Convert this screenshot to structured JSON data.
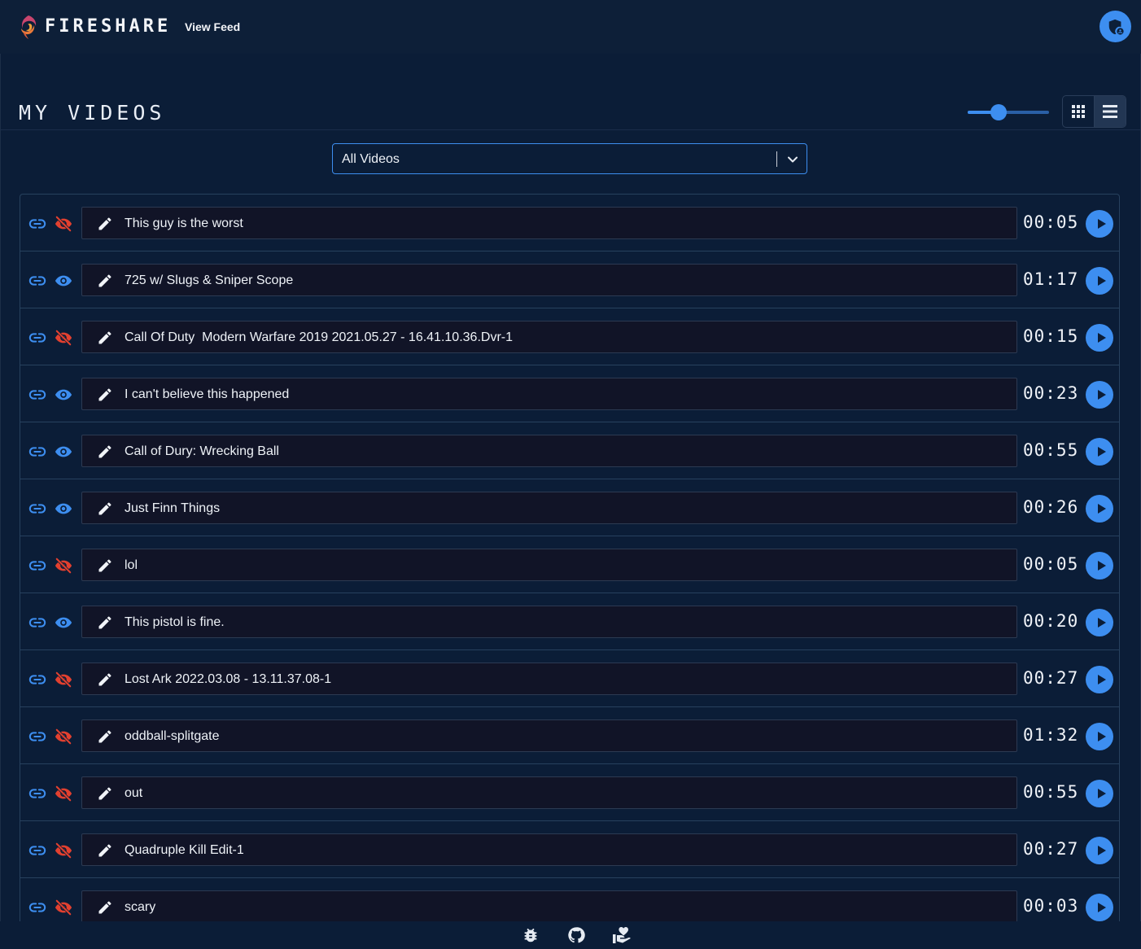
{
  "header": {
    "brand": "FIRESHARE",
    "nav_link": "View Feed",
    "avatar_icon": "shield-user-icon"
  },
  "page": {
    "title": "MY VIDEOS",
    "size_slider_value": 0.38,
    "view_modes": [
      "grid",
      "list"
    ],
    "active_view": "list"
  },
  "filter": {
    "selected": "All Videos"
  },
  "colors": {
    "accent": "#3d8ef0",
    "private": "#e2402f",
    "background": "#0b1d37"
  },
  "videos": [
    {
      "title": "This guy is the worst",
      "duration": "00:05",
      "visibility": "private"
    },
    {
      "title": "725 w/ Slugs & Sniper Scope",
      "duration": "01:17",
      "visibility": "public"
    },
    {
      "title": "Call Of Duty  Modern Warfare 2019 2021.05.27 - 16.41.10.36.Dvr-1",
      "duration": "00:15",
      "visibility": "private"
    },
    {
      "title": "I can't believe this happened",
      "duration": "00:23",
      "visibility": "public"
    },
    {
      "title": "Call of Dury: Wrecking Ball",
      "duration": "00:55",
      "visibility": "public"
    },
    {
      "title": "Just Finn Things",
      "duration": "00:26",
      "visibility": "public"
    },
    {
      "title": "lol",
      "duration": "00:05",
      "visibility": "private"
    },
    {
      "title": "This pistol is fine.",
      "duration": "00:20",
      "visibility": "public"
    },
    {
      "title": "Lost Ark 2022.03.08 - 13.11.37.08-1",
      "duration": "00:27",
      "visibility": "private"
    },
    {
      "title": "oddball-splitgate",
      "duration": "01:32",
      "visibility": "private"
    },
    {
      "title": "out",
      "duration": "00:55",
      "visibility": "private"
    },
    {
      "title": "Quadruple Kill Edit-1",
      "duration": "00:27",
      "visibility": "private"
    },
    {
      "title": "scary",
      "duration": "00:03",
      "visibility": "private"
    }
  ],
  "footer": {
    "icons": [
      "bug-icon",
      "github-icon",
      "donate-hand-heart-icon"
    ]
  }
}
